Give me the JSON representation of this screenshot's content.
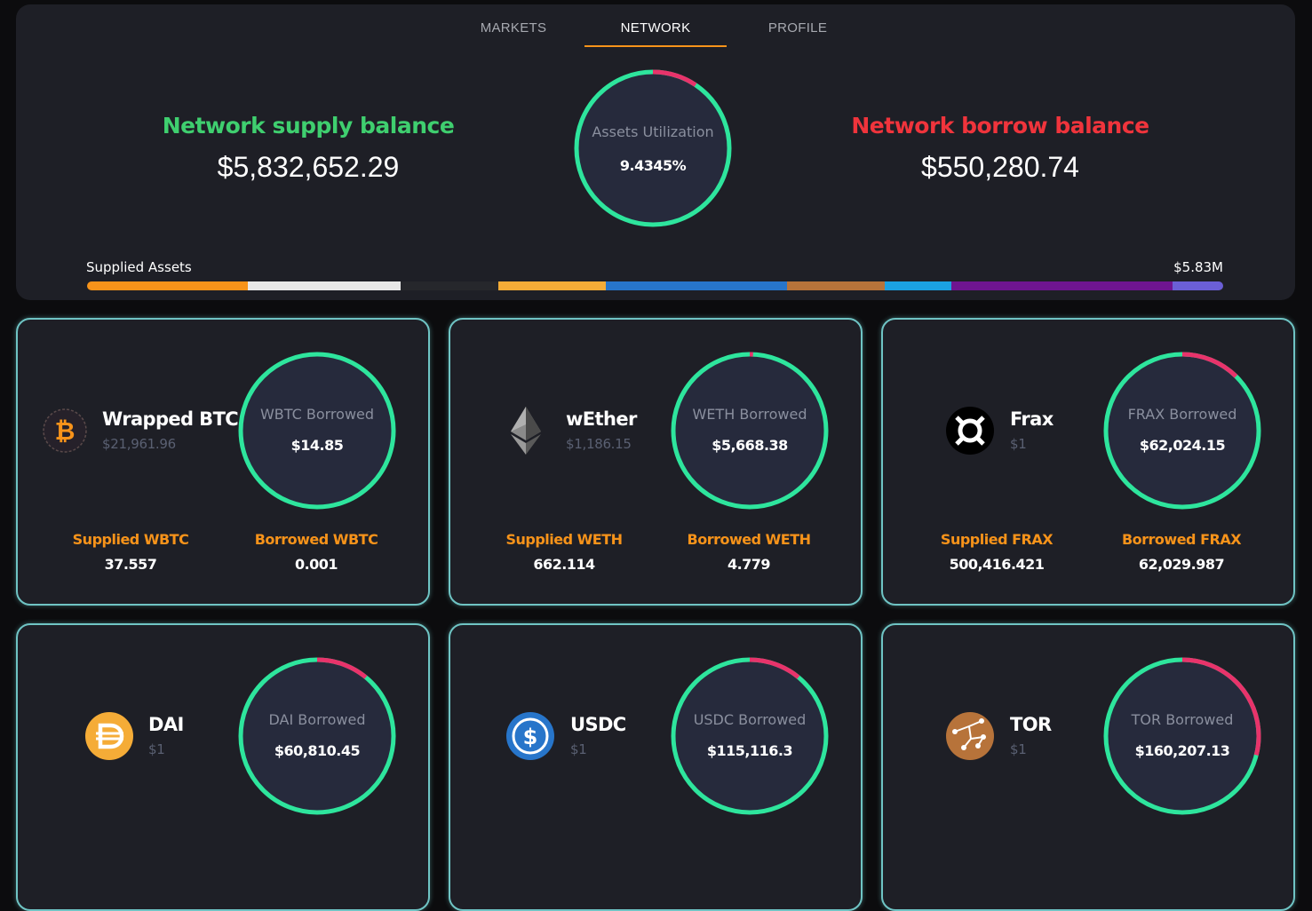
{
  "tabs": [
    {
      "label": "MARKETS"
    },
    {
      "label": "NETWORK"
    },
    {
      "label": "PROFILE"
    }
  ],
  "active_tab": "NETWORK",
  "colors": {
    "accent": "#f7931a",
    "supply": "#3fcf6f",
    "borrow": "#f0343c",
    "ring": "#2ee59d",
    "ring_borrow": "#e8336b"
  },
  "overview": {
    "supply_title": "Network supply balance",
    "supply_value": "$5,832,652.29",
    "borrow_title": "Network borrow balance",
    "borrow_value": "$550,280.74",
    "utilization_label": "Assets Utilization",
    "utilization_value": "9.4345%",
    "utilization_fraction": 0.094345
  },
  "supplied_assets": {
    "label": "Supplied Assets",
    "total": "$5.83M",
    "segments": [
      {
        "asset": "WBTC",
        "color": "#f7931a",
        "share": 0.1416
      },
      {
        "asset": "WETH",
        "color": "#e8e8e8",
        "share": 0.1346
      },
      {
        "asset": "FRAX",
        "color": "#26272c",
        "share": 0.086
      },
      {
        "asset": "DAI",
        "color": "#f5ac37",
        "share": 0.0946
      },
      {
        "asset": "USDC",
        "color": "#2775ca",
        "share": 0.1595
      },
      {
        "asset": "TOR",
        "color": "#b7733a",
        "share": 0.086
      },
      {
        "asset": "asset-7",
        "color": "#1ba1e2",
        "share": 0.0586
      },
      {
        "asset": "asset-8",
        "color": "#6f1590",
        "share": 0.1947
      },
      {
        "asset": "asset-9",
        "color": "#6b5fd6",
        "share": 0.0444
      }
    ]
  },
  "assets": [
    {
      "id": "wbtc",
      "name": "Wrapped BTC",
      "price": "$21,961.96",
      "icon": "bitcoin-icon",
      "borrowed_label": "WBTC Borrowed",
      "borrowed_value": "$14.85",
      "borrow_fraction": 0.0,
      "supplied_label": "Supplied WBTC",
      "supplied_amount": "37.557",
      "borrowed_amount_label": "Borrowed WBTC",
      "borrowed_amount": "0.001"
    },
    {
      "id": "weth",
      "name": "wEther",
      "price": "$1,186.15",
      "icon": "ethereum-icon",
      "borrowed_label": "WETH Borrowed",
      "borrowed_value": "$5,668.38",
      "borrow_fraction": 0.007,
      "supplied_label": "Supplied WETH",
      "supplied_amount": "662.114",
      "borrowed_amount_label": "Borrowed WETH",
      "borrowed_amount": "4.779"
    },
    {
      "id": "frax",
      "name": "Frax",
      "price": "$1",
      "icon": "frax-icon",
      "borrowed_label": "FRAX Borrowed",
      "borrowed_value": "$62,024.15",
      "borrow_fraction": 0.124,
      "supplied_label": "Supplied FRAX",
      "supplied_amount": "500,416.421",
      "borrowed_amount_label": "Borrowed FRAX",
      "borrowed_amount": "62,029.987"
    },
    {
      "id": "dai",
      "name": "DAI",
      "price": "$1",
      "icon": "dai-icon",
      "borrowed_label": "DAI Borrowed",
      "borrowed_value": "$60,810.45",
      "borrow_fraction": 0.11,
      "supplied_label": "",
      "supplied_amount": "",
      "borrowed_amount_label": "",
      "borrowed_amount": ""
    },
    {
      "id": "usdc",
      "name": "USDC",
      "price": "$1",
      "icon": "usdc-icon",
      "borrowed_label": "USDC Borrowed",
      "borrowed_value": "$115,116.3",
      "borrow_fraction": 0.11,
      "supplied_label": "",
      "supplied_amount": "",
      "borrowed_amount_label": "",
      "borrowed_amount": ""
    },
    {
      "id": "tor",
      "name": "TOR",
      "price": "$1",
      "icon": "tor-icon",
      "borrowed_label": "TOR Borrowed",
      "borrowed_value": "$160,207.13",
      "borrow_fraction": 0.29,
      "supplied_label": "",
      "supplied_amount": "",
      "borrowed_amount_label": "",
      "borrowed_amount": ""
    }
  ]
}
